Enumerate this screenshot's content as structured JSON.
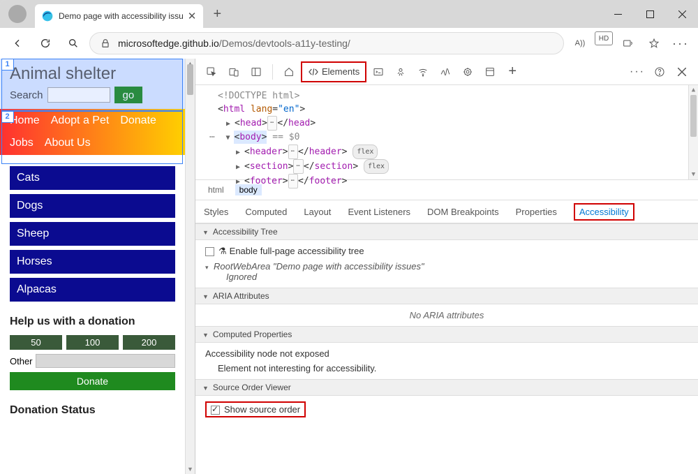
{
  "browser": {
    "tab_title": "Demo page with accessibility issu",
    "url_host": "microsoftedge.github.io",
    "url_path": "/Demos/devtools-a11y-testing/",
    "reading_mode_label": "A))",
    "hd_label": "HD"
  },
  "page": {
    "title": "Animal shelter",
    "search_label": "Search",
    "go_label": "go",
    "overlay1": "1",
    "overlay2": "2",
    "nav": [
      "Home",
      "Adopt a Pet",
      "Donate",
      "Jobs",
      "About Us"
    ],
    "categories": [
      "Cats",
      "Dogs",
      "Sheep",
      "Horses",
      "Alpacas"
    ],
    "donation_heading": "Help us with a donation",
    "amounts": [
      "50",
      "100",
      "200"
    ],
    "other_label": "Other",
    "donate_btn": "Donate",
    "status_heading": "Donation Status"
  },
  "devtools": {
    "elements_tab": "Elements",
    "dom": {
      "doctype": "<!DOCTYPE html>",
      "html_open": "html",
      "lang_attr": "lang",
      "lang_val": "\"en\"",
      "head": "head",
      "body": "body",
      "body_suffix": " == $0",
      "header": "header",
      "section": "section",
      "footer": "footer",
      "flex": "flex"
    },
    "crumbs": {
      "html": "html",
      "body": "body"
    },
    "subtabs": {
      "styles": "Styles",
      "computed": "Computed",
      "layout": "Layout",
      "listeners": "Event Listeners",
      "dom_bp": "DOM Breakpoints",
      "props": "Properties",
      "a11y": "Accessibility"
    },
    "a11y": {
      "tree_h": "Accessibility Tree",
      "enable_full": "Enable full-page accessibility tree",
      "root": "RootWebArea \"Demo page with accessibility issues\"",
      "ignored": "Ignored",
      "aria_h": "ARIA Attributes",
      "no_aria": "No ARIA attributes",
      "computed_h": "Computed Properties",
      "not_exposed": "Accessibility node not exposed",
      "not_interesting": "Element not interesting for accessibility.",
      "source_h": "Source Order Viewer",
      "show_source": "Show source order"
    }
  }
}
